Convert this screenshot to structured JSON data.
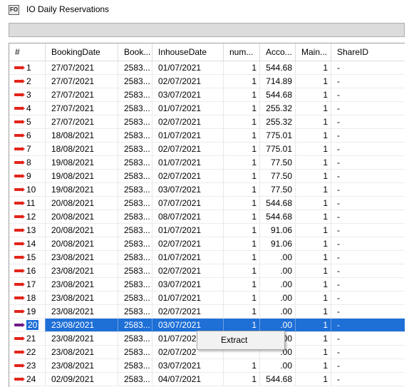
{
  "window": {
    "title": "IO Daily Reservations",
    "icon": "fo-app-icon",
    "icon_text": "FO"
  },
  "grid": {
    "columns": [
      {
        "label": "#"
      },
      {
        "label": "BookingDate"
      },
      {
        "label": "Book..."
      },
      {
        "label": "InhouseDate"
      },
      {
        "label": "num..."
      },
      {
        "label": "Acco..."
      },
      {
        "label": "Main..."
      },
      {
        "label": "ShareID"
      }
    ],
    "selected_row": 20,
    "rows": [
      [
        "1",
        "27/07/2021",
        "2583...",
        "01/07/2021",
        "1",
        "544.68",
        "1",
        "-"
      ],
      [
        "2",
        "27/07/2021",
        "2583...",
        "02/07/2021",
        "1",
        "714.89",
        "1",
        "-"
      ],
      [
        "3",
        "27/07/2021",
        "2583...",
        "03/07/2021",
        "1",
        "544.68",
        "1",
        "-"
      ],
      [
        "4",
        "27/07/2021",
        "2583...",
        "01/07/2021",
        "1",
        "255.32",
        "1",
        "-"
      ],
      [
        "5",
        "27/07/2021",
        "2583...",
        "02/07/2021",
        "1",
        "255.32",
        "1",
        "-"
      ],
      [
        "6",
        "18/08/2021",
        "2583...",
        "01/07/2021",
        "1",
        "775.01",
        "1",
        "-"
      ],
      [
        "7",
        "18/08/2021",
        "2583...",
        "02/07/2021",
        "1",
        "775.01",
        "1",
        "-"
      ],
      [
        "8",
        "19/08/2021",
        "2583...",
        "01/07/2021",
        "1",
        "77.50",
        "1",
        "-"
      ],
      [
        "9",
        "19/08/2021",
        "2583...",
        "02/07/2021",
        "1",
        "77.50",
        "1",
        "-"
      ],
      [
        "10",
        "19/08/2021",
        "2583...",
        "03/07/2021",
        "1",
        "77.50",
        "1",
        "-"
      ],
      [
        "11",
        "20/08/2021",
        "2583...",
        "07/07/2021",
        "1",
        "544.68",
        "1",
        "-"
      ],
      [
        "12",
        "20/08/2021",
        "2583...",
        "08/07/2021",
        "1",
        "544.68",
        "1",
        "-"
      ],
      [
        "13",
        "20/08/2021",
        "2583...",
        "01/07/2021",
        "1",
        "91.06",
        "1",
        "-"
      ],
      [
        "14",
        "20/08/2021",
        "2583...",
        "02/07/2021",
        "1",
        "91.06",
        "1",
        "-"
      ],
      [
        "15",
        "23/08/2021",
        "2583...",
        "01/07/2021",
        "1",
        ".00",
        "1",
        "-"
      ],
      [
        "16",
        "23/08/2021",
        "2583...",
        "02/07/2021",
        "1",
        ".00",
        "1",
        "-"
      ],
      [
        "17",
        "23/08/2021",
        "2583...",
        "03/07/2021",
        "1",
        ".00",
        "1",
        "-"
      ],
      [
        "18",
        "23/08/2021",
        "2583...",
        "01/07/2021",
        "1",
        ".00",
        "1",
        "-"
      ],
      [
        "19",
        "23/08/2021",
        "2583...",
        "02/07/2021",
        "1",
        ".00",
        "1",
        "-"
      ],
      [
        "20",
        "23/08/2021",
        "2583...",
        "03/07/2021",
        "1",
        ".00",
        "1",
        "-"
      ],
      [
        "21",
        "23/08/2021",
        "2583...",
        "01/07/202",
        "",
        ".00",
        "1",
        "-"
      ],
      [
        "22",
        "23/08/2021",
        "2583...",
        "02/07/202",
        "",
        ".00",
        "1",
        "-"
      ],
      [
        "23",
        "23/08/2021",
        "2583...",
        "03/07/2021",
        "1",
        ".00",
        "1",
        "-"
      ],
      [
        "24",
        "02/09/2021",
        "2583...",
        "04/07/2021",
        "1",
        "544.68",
        "1",
        "-"
      ]
    ]
  },
  "context_menu": {
    "items": [
      {
        "label": "Extract"
      }
    ]
  }
}
